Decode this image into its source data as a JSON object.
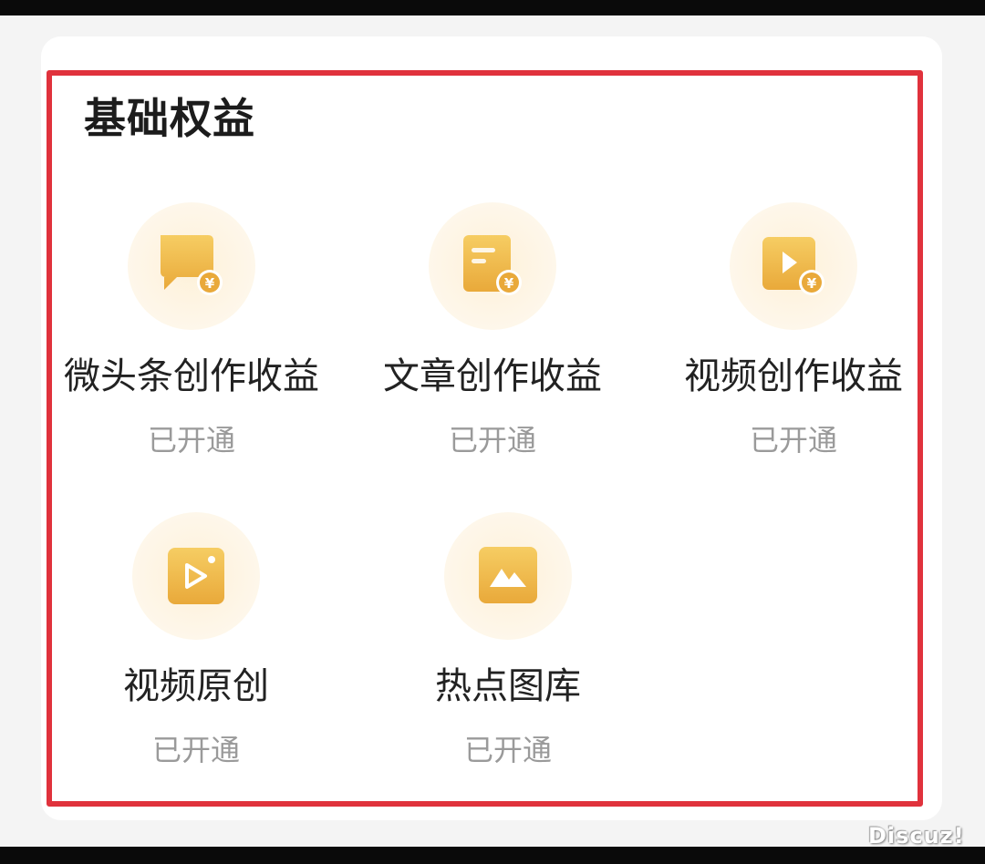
{
  "section": {
    "title": "基础权益"
  },
  "benefits": [
    {
      "label": "微头条创作收益",
      "status": "已开通",
      "icon": "message-yuan-icon"
    },
    {
      "label": "文章创作收益",
      "status": "已开通",
      "icon": "article-yuan-icon"
    },
    {
      "label": "视频创作收益",
      "status": "已开通",
      "icon": "video-yuan-icon"
    },
    {
      "label": "视频原创",
      "status": "已开通",
      "icon": "original-video-icon"
    },
    {
      "label": "热点图库",
      "status": "已开通",
      "icon": "image-gallery-icon"
    }
  ],
  "watermark": "Discuz!",
  "colors": {
    "highlight_border": "#e0323c",
    "icon_gold": "#f1bd4d",
    "icon_halo": "#fdf1d8",
    "status_text": "#9a9a9a"
  }
}
